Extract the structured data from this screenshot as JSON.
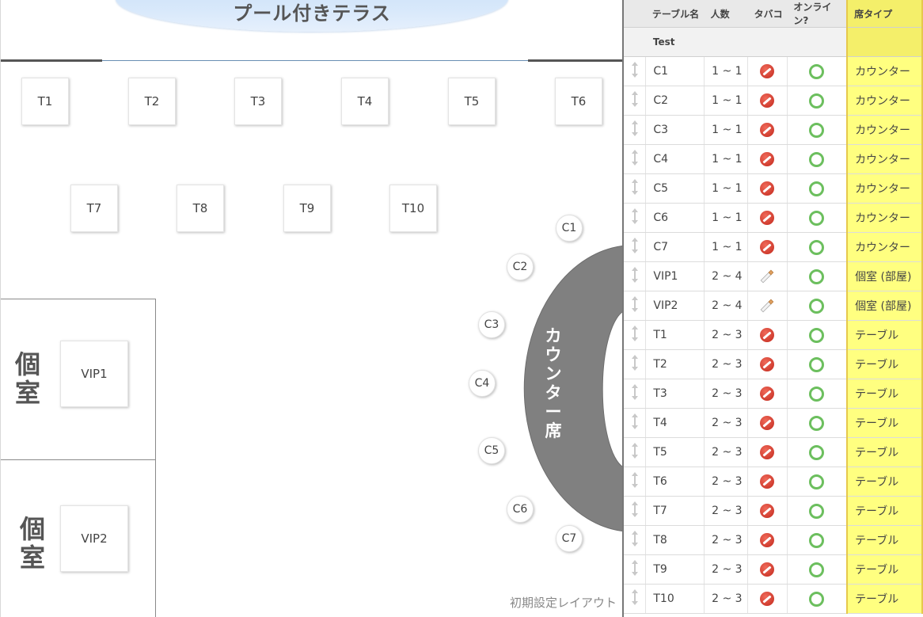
{
  "floor": {
    "pool_label": "プール付きテラス",
    "tables_row1": [
      "T1",
      "T2",
      "T3",
      "T4",
      "T5",
      "T6"
    ],
    "tables_row2": [
      "T7",
      "T8",
      "T9",
      "T10"
    ],
    "rooms": [
      {
        "label": "個室",
        "table": "VIP1"
      },
      {
        "label": "個室",
        "table": "VIP2"
      }
    ],
    "counter_label": "カウンター席",
    "counter_seats": [
      "C1",
      "C2",
      "C3",
      "C4",
      "C5",
      "C6",
      "C7"
    ],
    "layout_link": "初期設定レイアウト",
    "counter_color": "#808080"
  },
  "panel": {
    "headers": {
      "name": "テーブル名",
      "people": "人数",
      "smoking": "タバコ",
      "online": "オンライン?",
      "seat_type": "席タイプ"
    },
    "filter_text": "Test",
    "highlight_color": "#ffff80",
    "rows": [
      {
        "name": "C1",
        "people": "1 ~ 1",
        "smoking": "no-smoking-icon",
        "online": "ok-icon",
        "type": "カウンター"
      },
      {
        "name": "C2",
        "people": "1 ~ 1",
        "smoking": "no-smoking-icon",
        "online": "ok-icon",
        "type": "カウンター"
      },
      {
        "name": "C3",
        "people": "1 ~ 1",
        "smoking": "no-smoking-icon",
        "online": "ok-icon",
        "type": "カウンター"
      },
      {
        "name": "C4",
        "people": "1 ~ 1",
        "smoking": "no-smoking-icon",
        "online": "ok-icon",
        "type": "カウンター"
      },
      {
        "name": "C5",
        "people": "1 ~ 1",
        "smoking": "no-smoking-icon",
        "online": "ok-icon",
        "type": "カウンター"
      },
      {
        "name": "C6",
        "people": "1 ~ 1",
        "smoking": "no-smoking-icon",
        "online": "ok-icon",
        "type": "カウンター"
      },
      {
        "name": "C7",
        "people": "1 ~ 1",
        "smoking": "no-smoking-icon",
        "online": "ok-icon",
        "type": "カウンター"
      },
      {
        "name": "VIP1",
        "people": "2 ~ 4",
        "smoking": "cigarette-icon",
        "online": "ok-icon",
        "type": "個室 (部屋)"
      },
      {
        "name": "VIP2",
        "people": "2 ~ 4",
        "smoking": "cigarette-icon",
        "online": "ok-icon",
        "type": "個室 (部屋)"
      },
      {
        "name": "T1",
        "people": "2 ~ 3",
        "smoking": "no-smoking-icon",
        "online": "ok-icon",
        "type": "テーブル"
      },
      {
        "name": "T2",
        "people": "2 ~ 3",
        "smoking": "no-smoking-icon",
        "online": "ok-icon",
        "type": "テーブル"
      },
      {
        "name": "T3",
        "people": "2 ~ 3",
        "smoking": "no-smoking-icon",
        "online": "ok-icon",
        "type": "テーブル"
      },
      {
        "name": "T4",
        "people": "2 ~ 3",
        "smoking": "no-smoking-icon",
        "online": "ok-icon",
        "type": "テーブル"
      },
      {
        "name": "T5",
        "people": "2 ~ 3",
        "smoking": "no-smoking-icon",
        "online": "ok-icon",
        "type": "テーブル"
      },
      {
        "name": "T6",
        "people": "2 ~ 3",
        "smoking": "no-smoking-icon",
        "online": "ok-icon",
        "type": "テーブル"
      },
      {
        "name": "T7",
        "people": "2 ~ 3",
        "smoking": "no-smoking-icon",
        "online": "ok-icon",
        "type": "テーブル"
      },
      {
        "name": "T8",
        "people": "2 ~ 3",
        "smoking": "no-smoking-icon",
        "online": "ok-icon",
        "type": "テーブル"
      },
      {
        "name": "T9",
        "people": "2 ~ 3",
        "smoking": "no-smoking-icon",
        "online": "ok-icon",
        "type": "テーブル"
      },
      {
        "name": "T10",
        "people": "2 ~ 3",
        "smoking": "no-smoking-icon",
        "online": "ok-icon",
        "type": "テーブル"
      }
    ]
  }
}
